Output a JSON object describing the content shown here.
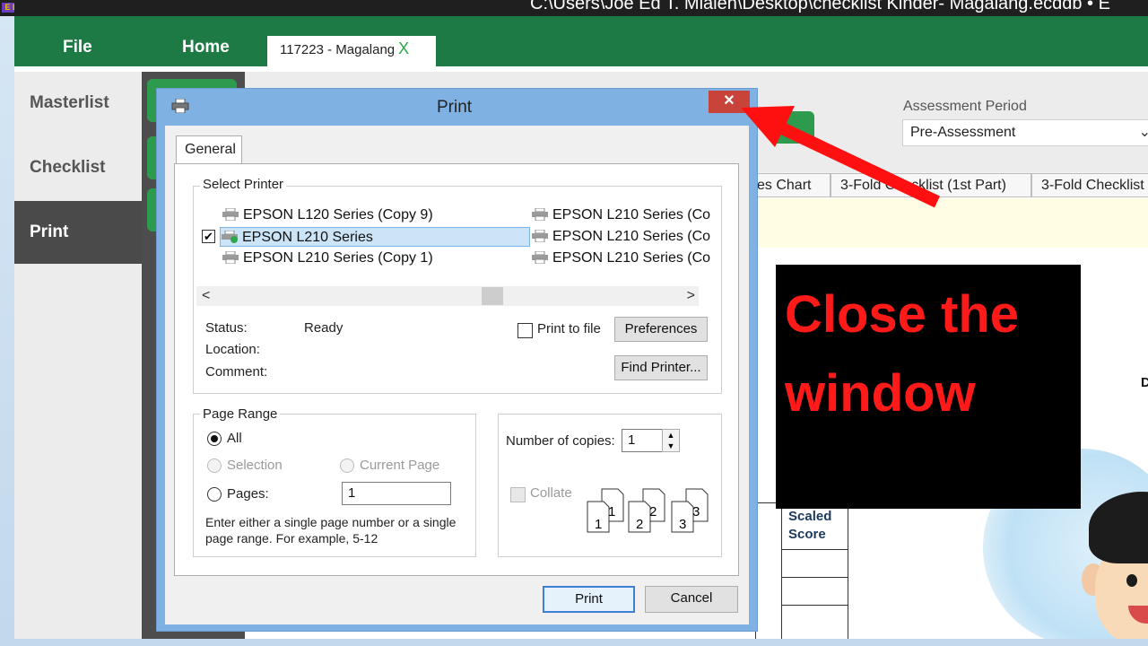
{
  "window": {
    "title": "C:\\Users\\Joe Ed T. Mialen\\Desktop\\checklist Kinder- Magalang.ecddb  •  E",
    "badge": "E D"
  },
  "ribbon": {
    "file": "File",
    "home": "Home",
    "doc_tab": "117223 -  Magalang",
    "doc_tab_close": "X"
  },
  "sidebar": {
    "items": [
      {
        "label": "Masterlist"
      },
      {
        "label": "Checklist"
      },
      {
        "label": "Print"
      }
    ]
  },
  "content": {
    "assessment_label": "Assessment Period",
    "assessment_value": "Pre-Assessment",
    "tabs": [
      "es Chart",
      "3-Fold Checklist (1st Part)",
      "3-Fold Checklist ("
    ],
    "table_header": "Scaled\nScore",
    "stray_letter": "D"
  },
  "annotation": {
    "line1": "Close the",
    "line2": "window"
  },
  "dialog": {
    "title": "Print",
    "close": "✕",
    "tab_general": "General",
    "select_printer": "Select Printer",
    "printers_left": [
      "EPSON L120 Series (Copy 9)",
      "EPSON L210 Series",
      "EPSON L210 Series (Copy 1)"
    ],
    "printers_right": [
      "EPSON L210 Series (Co",
      "EPSON L210 Series (Co",
      "EPSON L210 Series (Co"
    ],
    "status_label": "Status:",
    "status_value": "Ready",
    "location_label": "Location:",
    "comment_label": "Comment:",
    "print_to_file": "Print to file",
    "preferences": "Preferences",
    "find_printer": "Find Printer...",
    "page_range": "Page Range",
    "all": "All",
    "selection": "Selection",
    "current_page": "Current Page",
    "pages": "Pages:",
    "pages_value": "1",
    "hint_line1": "Enter either a single page number or a single",
    "hint_line2": "page range.  For example, 5-12",
    "copies_label": "Number of copies:",
    "copies_value": "1",
    "collate": "Collate",
    "print_btn": "Print",
    "cancel_btn": "Cancel",
    "collate_labels": [
      "1",
      "1",
      "2",
      "2",
      "3",
      "3"
    ]
  }
}
